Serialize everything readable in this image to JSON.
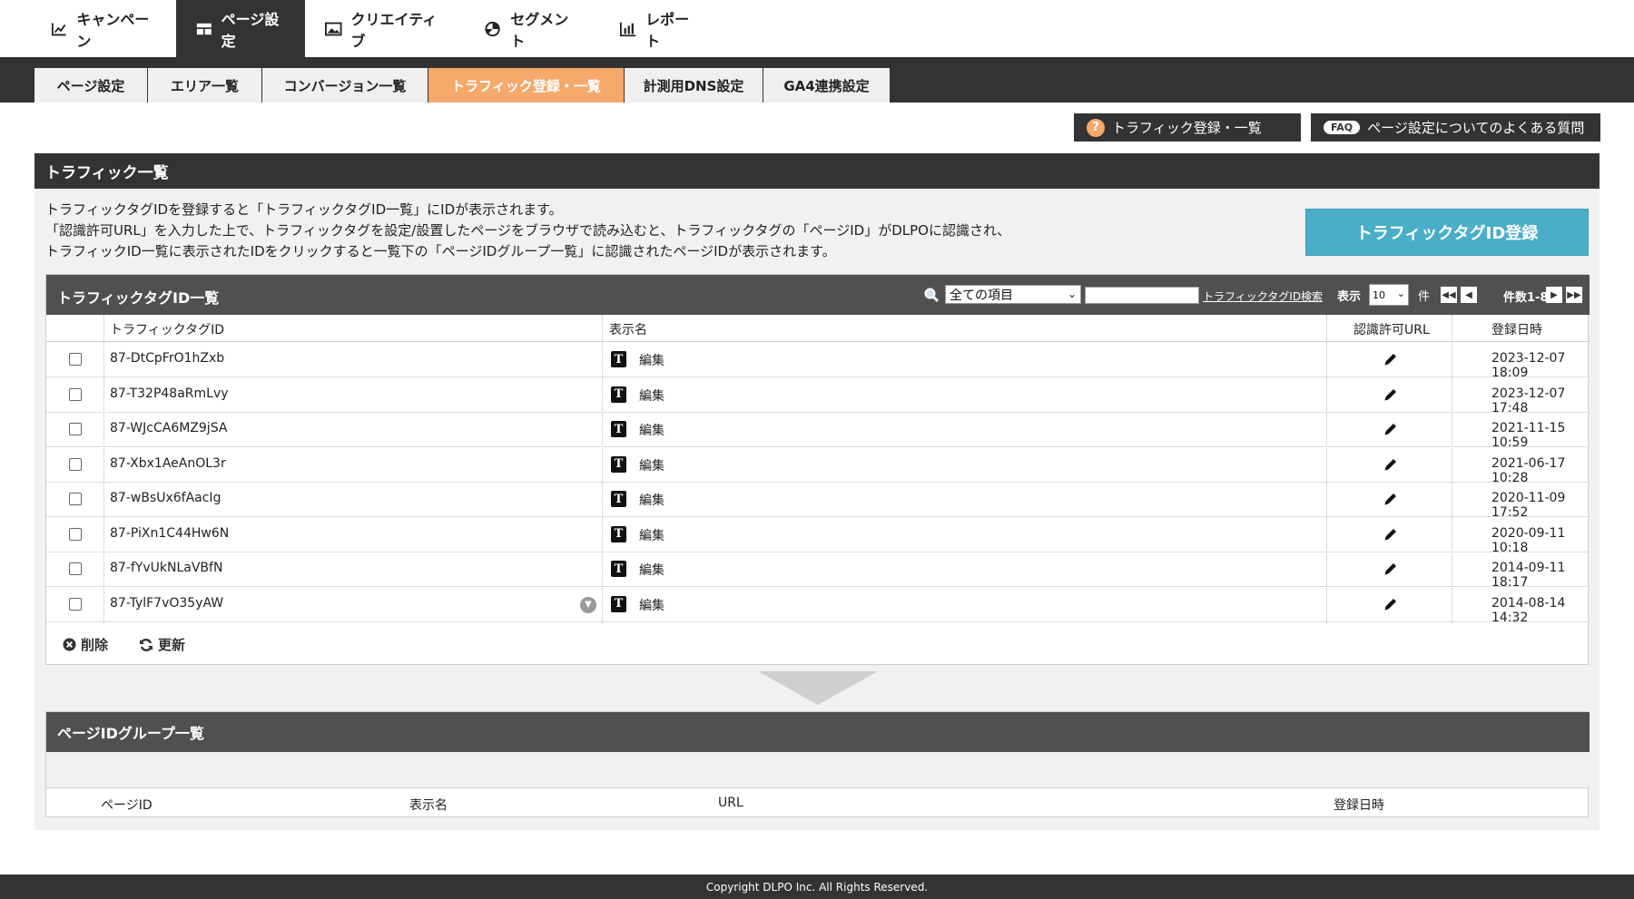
{
  "topnav": {
    "tabs": [
      {
        "label": "キャンペーン",
        "icon": "campaign-chart-icon"
      },
      {
        "label": "ページ設定",
        "icon": "page-layout-icon"
      },
      {
        "label": "クリエイティブ",
        "icon": "image-icon"
      },
      {
        "label": "セグメント",
        "icon": "pie-chart-icon"
      },
      {
        "label": "レポート",
        "icon": "bar-chart-icon"
      }
    ],
    "active_index": 1
  },
  "subnav": {
    "tabs": [
      {
        "label": "ページ設定"
      },
      {
        "label": "エリア一覧"
      },
      {
        "label": "コンバージョン一覧"
      },
      {
        "label": "トラフィック登録・一覧"
      },
      {
        "label": "計測用DNS設定"
      },
      {
        "label": "GA4連携設定"
      }
    ],
    "active_index": 3,
    "active_color": "#f5a96b"
  },
  "help": {
    "traffic_help": "トラフィック登録・一覧",
    "question_mark": "?",
    "faq_pill": "FAQ",
    "faq_label": "ページ設定についてのよくある質問"
  },
  "panel": {
    "title": "トラフィック一覧",
    "desc_lines": [
      "トラフィックタグIDを登録すると「トラフィックタグID一覧」にIDが表示されます。",
      "「認識許可URL」を入力した上で、トラフィックタグを設定/設置したページをブラウザで読み込むと、トラフィックタグの「ページID」がDLPOに認識され、",
      "トラフィックID一覧に表示されたIDをクリックすると一覧下の「ページIDグループ一覧」に認識されたページIDが表示されます。"
    ],
    "register_button": "トラフィックタグID登録",
    "accent_color": "#4aaec6"
  },
  "list": {
    "title": "トラフィックタグID一覧",
    "filter_selected": "全ての項目",
    "search_value": "",
    "search_link": "トラフィックタグID検索",
    "show_label": "表示",
    "show_selected": "10",
    "ken_label": "件",
    "count_text": "件数1-8/8",
    "columns": {
      "tag_id": "トラフィックタグID",
      "display_name": "表示名",
      "allowed_url": "認識許可URL",
      "registered": "登録日時"
    },
    "edit_label": "編集",
    "t_icon_text": "T",
    "rows": [
      {
        "tag_id": "87-DtCpFrO1hZxb",
        "registered": "2023-12-07 18:09"
      },
      {
        "tag_id": "87-T32P48aRmLvy",
        "registered": "2023-12-07 17:48"
      },
      {
        "tag_id": "87-WJcCA6MZ9jSA",
        "registered": "2021-11-15 10:59"
      },
      {
        "tag_id": "87-Xbx1AeAnOL3r",
        "registered": "2021-06-17 10:28"
      },
      {
        "tag_id": "87-wBsUx6fAacIg",
        "registered": "2020-11-09 17:52"
      },
      {
        "tag_id": "87-PiXn1C44Hw6N",
        "registered": "2020-09-11 10:18"
      },
      {
        "tag_id": "87-fYvUkNLaVBfN",
        "registered": "2014-09-11 18:17"
      },
      {
        "tag_id": "87-TylF7vO35yAW",
        "registered": "2014-08-14 14:32"
      }
    ],
    "delete_label": "削除",
    "refresh_label": "更新"
  },
  "group_list": {
    "title": "ページIDグループ一覧",
    "columns": {
      "page_id": "ページID",
      "display_name": "表示名",
      "url": "URL",
      "registered": "登録日時"
    }
  },
  "footer": {
    "copyright": "Copyright DLPO Inc. All Rights Reserved."
  }
}
